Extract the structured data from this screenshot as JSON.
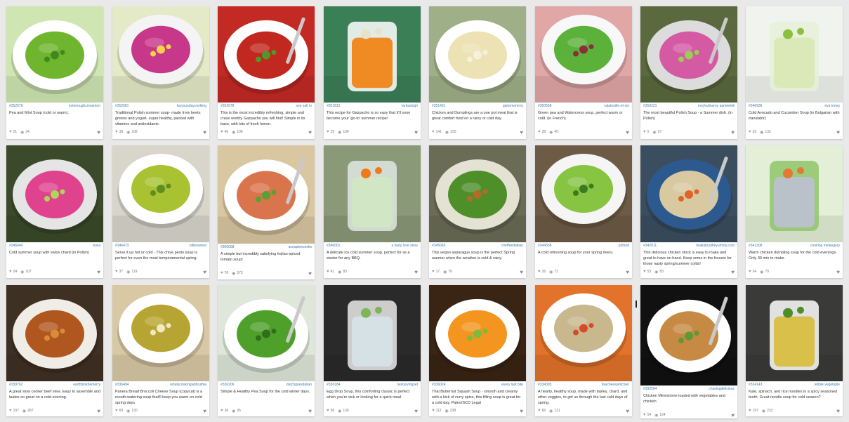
{
  "cards": [
    {
      "id": "#352679",
      "author": "notenoughcinnamon",
      "text": "Pea and Mint Soup (cold or warm).",
      "likes": "21",
      "views": "34",
      "colors": {
        "bg": "#cfe6b3",
        "bowl": "#ffffff",
        "soup": "#6fb52d",
        "garnish": "#3e8a1f"
      }
    },
    {
      "id": "#352681",
      "author": "lazysundaycooking",
      "text": "Traditional Polish summer soup- made from beets greens and yogurt- super healthy, packed with vitamins and antioxidants.",
      "likes": "39",
      "views": "108",
      "colors": {
        "bg": "#e4eac8",
        "bowl": "#f4f4f4",
        "soup": "#c7378a",
        "garnish": "#f5d24c"
      }
    },
    {
      "id": "#352078",
      "author": "see salt tv",
      "text": "This is the most incredibly refreshing, simple and crave worthy Gazpacho you will find! Simple in its base, with lots of fresh lemon.",
      "likes": "46",
      "views": "106",
      "colors": {
        "bg": "#c42a24",
        "bowl": "#ffffff",
        "soup": "#c1281f",
        "garnish": "#4c9a2a"
      }
    },
    {
      "id": "#351813",
      "author": "tarkasingh",
      "text": "This recipe for Gazpacho is so easy that it'll soon become your 'go-to' summer recipe!",
      "likes": "29",
      "views": "109",
      "colors": {
        "bg": "#3b7f56",
        "bowl": "#ffffff",
        "soup": "#f08a22",
        "garnish": "#e8e2c8"
      }
    },
    {
      "id": "#351431",
      "author": "gatormommy",
      "text": "Chicken and Dumplings are a one pot meal that is great comfort food on a rainy or cold day.",
      "likes": "141",
      "views": "220",
      "colors": {
        "bg": "#9fb088",
        "bowl": "#ffffff",
        "soup": "#ece2b3",
        "garnish": "#f4f1e0"
      }
    },
    {
      "id": "#350568",
      "author": "ratatouille-et-cie",
      "text": "Green pea and Watercress soup, perfect warm or cold. (in French)",
      "likes": "28",
      "views": "45",
      "colors": {
        "bg": "#e1a6a6",
        "bowl": "#f8f8f8",
        "soup": "#5cb13a",
        "garnish": "#8c2d3a"
      }
    },
    {
      "id": "#350231",
      "author": "moj kulinarny pamietnik",
      "text": "The most beautiful Polish Soup - a Summer dish. (in Polish)",
      "likes": "5",
      "views": "57",
      "colors": {
        "bg": "#5b6a3e",
        "bowl": "#dcdcdc",
        "soup": "#d45aa4",
        "garnish": "#9ccc54"
      }
    },
    {
      "id": "#346936",
      "author": "eva tones",
      "text": "Cold Avocado and Cucumber Soup (in Bulgarian with translator)",
      "likes": "63",
      "views": "133",
      "colors": {
        "bg": "#f1f3ef",
        "bowl": "#e6f0d8",
        "soup": "#dbe9b8",
        "garnish": "#8dbf3e"
      }
    },
    {
      "id": "#346640",
      "author": "tosia",
      "text": "Cold summer soup with swiss chard (in Polish)",
      "likes": "24",
      "views": "107",
      "colors": {
        "bg": "#3b4a2a",
        "bowl": "#e5e5e5",
        "soup": "#e0438e",
        "garnish": "#b2d35a"
      }
    },
    {
      "id": "#346473",
      "author": "bittersweet",
      "text": "Serve it up hot or cold - This chive pesto soup is perfect for even the most temperamental spring.",
      "likes": "37",
      "views": "119",
      "colors": {
        "bg": "#d8d6cb",
        "bowl": "#ffffff",
        "soup": "#a9c232",
        "garnish": "#5f8e20"
      }
    },
    {
      "id": "#300658",
      "author": "aceupleecooks",
      "text": "A simple but incredibly satisfying Indian-spiced tomato soup!",
      "likes": "76",
      "views": "573",
      "colors": {
        "bg": "#d9c7a2",
        "bowl": "#ffffff",
        "soup": "#d9744c",
        "garnish": "#55a235"
      }
    },
    {
      "id": "#346001",
      "author": "a tasty love story",
      "text": "A delicate ice cold summer soup, perfect for as a starter for any BBQ.",
      "likes": "41",
      "views": "83",
      "colors": {
        "bg": "#8a9a78",
        "bowl": "#dfe8e2",
        "soup": "#d1e6c4",
        "garnish": "#f07a1a"
      }
    },
    {
      "id": "#345065",
      "author": "cheffeedtalian",
      "text": "This vegan asparagus soup is the perfect Spring warmer when the weather is cold & rainy.",
      "likes": "17",
      "views": "70",
      "colors": {
        "bg": "#6a6c56",
        "bowl": "#e4e2d2",
        "soup": "#4e8f2a",
        "garnish": "#b56a2a"
      }
    },
    {
      "id": "#344338",
      "author": "p2food",
      "text": "A cold refreshing soup for your spring menu",
      "likes": "26",
      "views": "72",
      "colors": {
        "bg": "#6d5b45",
        "bowl": "#f5f5f5",
        "soup": "#86c442",
        "garnish": "#3c7a1f"
      }
    },
    {
      "id": "#342011",
      "author": "itsallaboutheyummy.com",
      "text": "This delicious chicken stock is easy to make and great to have on hand. Keep some in the freezer for those nasty spring/summer colds!",
      "likes": "53",
      "views": "83",
      "colors": {
        "bg": "#3b4e5f",
        "bowl": "#2c5a8f",
        "soup": "#d8c9a0",
        "garnish": "#e2622a"
      }
    },
    {
      "id": "#341308",
      "author": "cooking melangery",
      "text": "Warm chicken dumpling soup for the cold evenings. Only 30 min to make.",
      "likes": "54",
      "views": "70",
      "colors": {
        "bg": "#e3efd6",
        "bowl": "#8fc46a",
        "soup": "#b9c2c8",
        "garnish": "#e27a36"
      }
    },
    {
      "id": "#339762",
      "author": "earthhinkbemerry",
      "text": "A great slow cooker beef stew. Easy to assemble and tastes so great on a cold evening.",
      "likes": "107",
      "views": "287",
      "colors": {
        "bg": "#3f3024",
        "bowl": "#f0ece6",
        "soup": "#b0571f",
        "garnish": "#d98b3a"
      }
    },
    {
      "id": "#336494",
      "author": "whatscookingwithruthie",
      "text": "Panera Bread Broccoli Cheese Soup (copycat) is a mouth-watering soup that'll keep you warm on cold spring days",
      "likes": "69",
      "views": "130",
      "colors": {
        "bg": "#d8c8a4",
        "bowl": "#ffffff",
        "soup": "#b7a533",
        "garnish": "#f1e9c1"
      }
    },
    {
      "id": "#336206",
      "author": "dutchgoesitalian",
      "text": "Simple & Healthy Pea Soup for the cold winter days.",
      "likes": "36",
      "views": "95",
      "colors": {
        "bg": "#dee7d9",
        "bowl": "#ffffff",
        "soup": "#4ea02b",
        "garnish": "#2f6f1a"
      }
    },
    {
      "id": "#336184",
      "author": "nestarvingyet",
      "text": "Egg Drop Soup, this comforting classic is perfect when you're sick or looking for a quick meal.",
      "likes": "58",
      "views": "130",
      "colors": {
        "bg": "#2a2a2a",
        "bowl": "#eaeaea",
        "soup": "#d6e1e6",
        "garnish": "#7fb55a"
      }
    },
    {
      "id": "#336024",
      "author": "every last bite",
      "text": "Thai Butternut Squash Soup - smooth and creamy with a kick of curry spice, this filling soup is great for a cold day. Paleo/SCD Legal",
      "likes": "112",
      "views": "238",
      "colors": {
        "bg": "#3a2414",
        "bowl": "#ffffff",
        "soup": "#f3951e",
        "garnish": "#7dbb3c"
      }
    },
    {
      "id": "#334395",
      "author": "lisacheesykitchen",
      "text": "A hearty, healthy soup, made with barley, chard, and other veggies, to get us through the last cold days of spring.",
      "likes": "66",
      "views": "121",
      "colors": {
        "bg": "#e3722a",
        "bowl": "#ffffff",
        "soup": "#c9b88d",
        "garnish": "#d64a2a"
      }
    },
    {
      "id": "#332594",
      "author": "chasingdelicious",
      "text": "Chicken Minestrone loaded with vegetables and chicken",
      "likes": "54",
      "views": "124",
      "colors": {
        "bg": "#111111",
        "bowl": "#ffffff",
        "soup": "#c68a45",
        "garnish": "#5e9a34"
      }
    },
    {
      "id": "#334143",
      "author": "edible vegetable",
      "text": "Kale, spinach, and rice noodles in a spicy seasoned broth. Great noodle soup for cold season?",
      "likes": "197",
      "views": "233",
      "colors": {
        "bg": "#3a3a38",
        "bowl": "#ffffff",
        "soup": "#d8c04a",
        "garnish": "#4e8e2a"
      }
    }
  ]
}
